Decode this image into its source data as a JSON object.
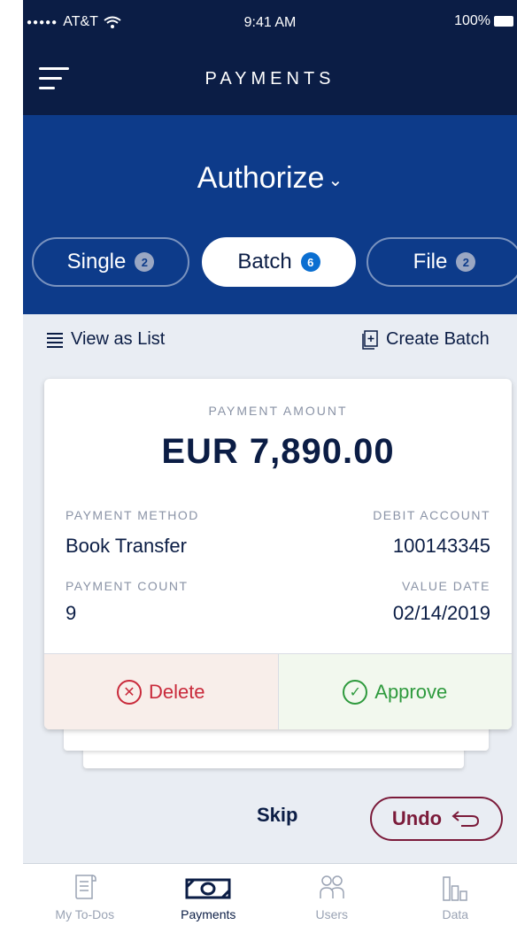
{
  "status": {
    "carrier": "AT&T",
    "time": "9:41 AM",
    "battery": "100%"
  },
  "nav": {
    "title": "PAYMENTS"
  },
  "header": {
    "title": "Authorize",
    "segments": [
      {
        "label": "Single",
        "count": "2"
      },
      {
        "label": "Batch",
        "count": "6"
      },
      {
        "label": "File",
        "count": "2"
      }
    ]
  },
  "toolbar": {
    "view_list": "View as List",
    "create_batch": "Create Batch"
  },
  "card": {
    "amount_label": "PAYMENT AMOUNT",
    "amount": "EUR 7,890.00",
    "method_label": "PAYMENT METHOD",
    "method": "Book Transfer",
    "debit_label": "DEBIT ACCOUNT",
    "debit": "100143345",
    "count_label": "PAYMENT COUNT",
    "count": "9",
    "date_label": "VALUE DATE",
    "date": "02/14/2019",
    "delete": "Delete",
    "approve": "Approve"
  },
  "footer": {
    "skip": "Skip",
    "undo": "Undo"
  },
  "tabs": [
    {
      "label": "My To-Dos"
    },
    {
      "label": "Payments"
    },
    {
      "label": "Users"
    },
    {
      "label": "Data"
    }
  ]
}
